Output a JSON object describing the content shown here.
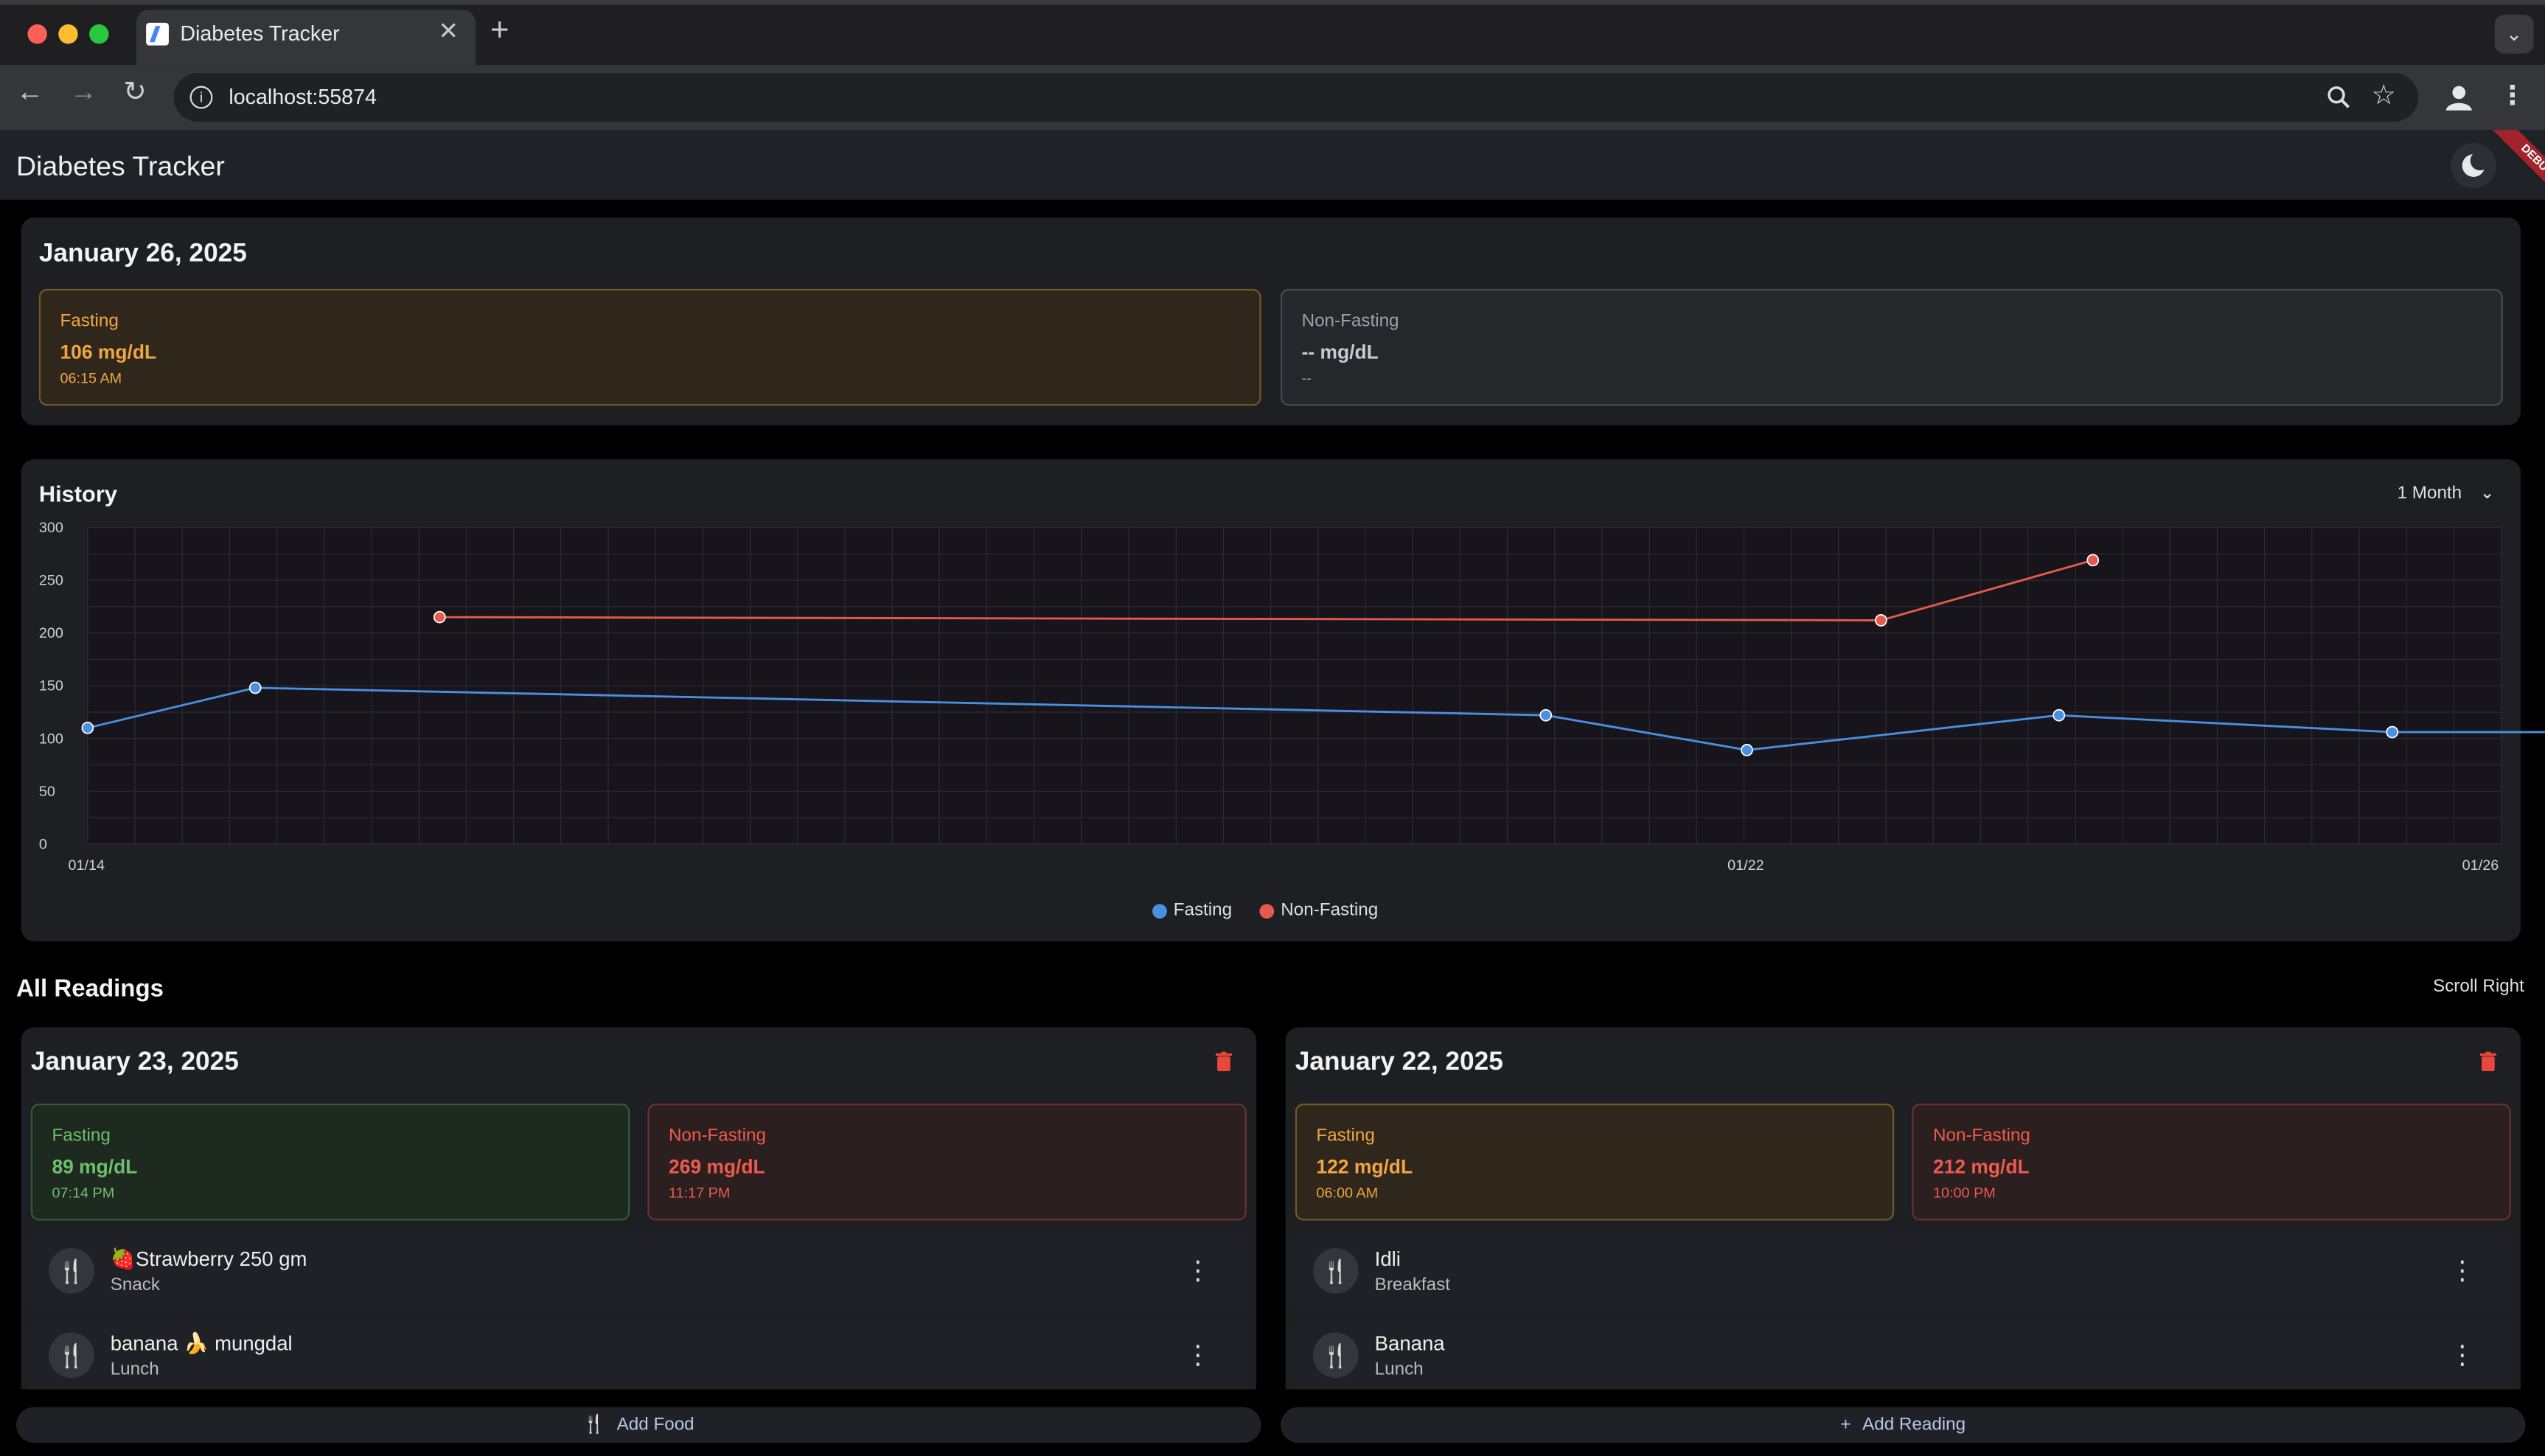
{
  "browser": {
    "tab_title": "Diabetes Tracker",
    "url": "localhost:55874"
  },
  "app": {
    "title": "Diabetes Tracker",
    "debug_label": "DEBUG"
  },
  "today": {
    "date": "January 26, 2025",
    "fasting": {
      "label": "Fasting",
      "value": "106 mg/dL",
      "time": "06:15 AM"
    },
    "non_fasting": {
      "label": "Non-Fasting",
      "value": "-- mg/dL",
      "time": "--"
    }
  },
  "history": {
    "title": "History",
    "range_label": "1 Month"
  },
  "chart_data": {
    "type": "line",
    "title": "History",
    "ylim": [
      0,
      300
    ],
    "yticks": [
      0,
      50,
      100,
      150,
      200,
      250,
      300
    ],
    "xlim": [
      "2025-01-14",
      "2025-01-26"
    ],
    "xticks": [
      "01/14",
      "01/22",
      "01/26"
    ],
    "grid": true,
    "legend": "bottom-center",
    "series": [
      {
        "name": "Fasting",
        "color": "#4a90e2",
        "x": [
          "2025-01-14",
          "2025-01-14 20:00",
          "2025-01-21 06:00",
          "2025-01-22 06:00",
          "2025-01-23 19:14",
          "2025-01-25 11:00",
          "2025-01-26 06:15"
        ],
        "values": [
          110,
          148,
          122,
          89,
          122,
          106,
          106
        ]
      },
      {
        "name": "Non-Fasting",
        "color": "#e65a4d",
        "x": [
          "2025-01-15 18:00",
          "2025-01-22 22:00",
          "2025-01-23 23:17"
        ],
        "values": [
          215,
          212,
          269
        ]
      }
    ]
  },
  "all_readings": {
    "title": "All Readings",
    "scroll_hint": "Scroll Right",
    "days": [
      {
        "date": "January 23, 2025",
        "fasting": {
          "label": "Fasting",
          "value": "89 mg/dL",
          "time": "07:14 PM"
        },
        "non_fasting": {
          "label": "Non-Fasting",
          "value": "269 mg/dL",
          "time": "11:17 PM"
        },
        "foods": [
          {
            "name": "🍓Strawberry 250 gm",
            "meal": "Snack"
          },
          {
            "name": "banana 🍌 mungdal",
            "meal": "Lunch"
          }
        ]
      },
      {
        "date": "January 22, 2025",
        "fasting": {
          "label": "Fasting",
          "value": "122 mg/dL",
          "time": "06:00 AM"
        },
        "non_fasting": {
          "label": "Non-Fasting",
          "value": "212 mg/dL",
          "time": "10:00 PM"
        },
        "foods": [
          {
            "name": "Idli",
            "meal": "Breakfast"
          },
          {
            "name": "Banana",
            "meal": "Lunch"
          }
        ]
      }
    ]
  },
  "actions": {
    "add_food": "Add Food",
    "add_reading": "Add Reading"
  }
}
